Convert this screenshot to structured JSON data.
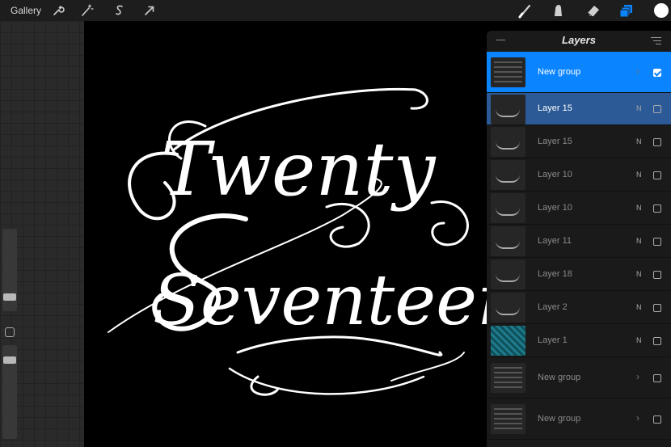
{
  "app": {
    "gallery_label": "Gallery"
  },
  "toolbar": {
    "left_tools": [
      "wrench-icon",
      "magic-wand-icon",
      "selection-s-icon",
      "transform-arrow-icon"
    ],
    "right_tools": [
      "brush-icon",
      "smudge-icon",
      "eraser-icon",
      "layers-icon",
      "color-swatch"
    ],
    "active_color": "#ffffff",
    "layers_accent": "#0a84ff"
  },
  "artwork": {
    "line1": "Twenty",
    "line2": "Seventeen"
  },
  "layers_panel": {
    "title": "Layers",
    "layers": [
      {
        "name": "New group",
        "mode": "",
        "group": true,
        "visible": true
      },
      {
        "name": "Layer 15",
        "mode": "N",
        "group": false,
        "visible": false
      },
      {
        "name": "Layer 15",
        "mode": "N",
        "group": false,
        "visible": false
      },
      {
        "name": "Layer 10",
        "mode": "N",
        "group": false,
        "visible": false
      },
      {
        "name": "Layer 10",
        "mode": "N",
        "group": false,
        "visible": false
      },
      {
        "name": "Layer 11",
        "mode": "N",
        "group": false,
        "visible": false
      },
      {
        "name": "Layer 18",
        "mode": "N",
        "group": false,
        "visible": false
      },
      {
        "name": "Layer 2",
        "mode": "N",
        "group": false,
        "visible": false
      },
      {
        "name": "Layer 1",
        "mode": "N",
        "group": false,
        "visible": false
      },
      {
        "name": "New group",
        "mode": "",
        "group": true,
        "visible": false
      },
      {
        "name": "New group",
        "mode": "",
        "group": true,
        "visible": false
      }
    ]
  },
  "sidebar": {
    "brush_size_level": 0.25,
    "opacity_level": 0.95
  }
}
